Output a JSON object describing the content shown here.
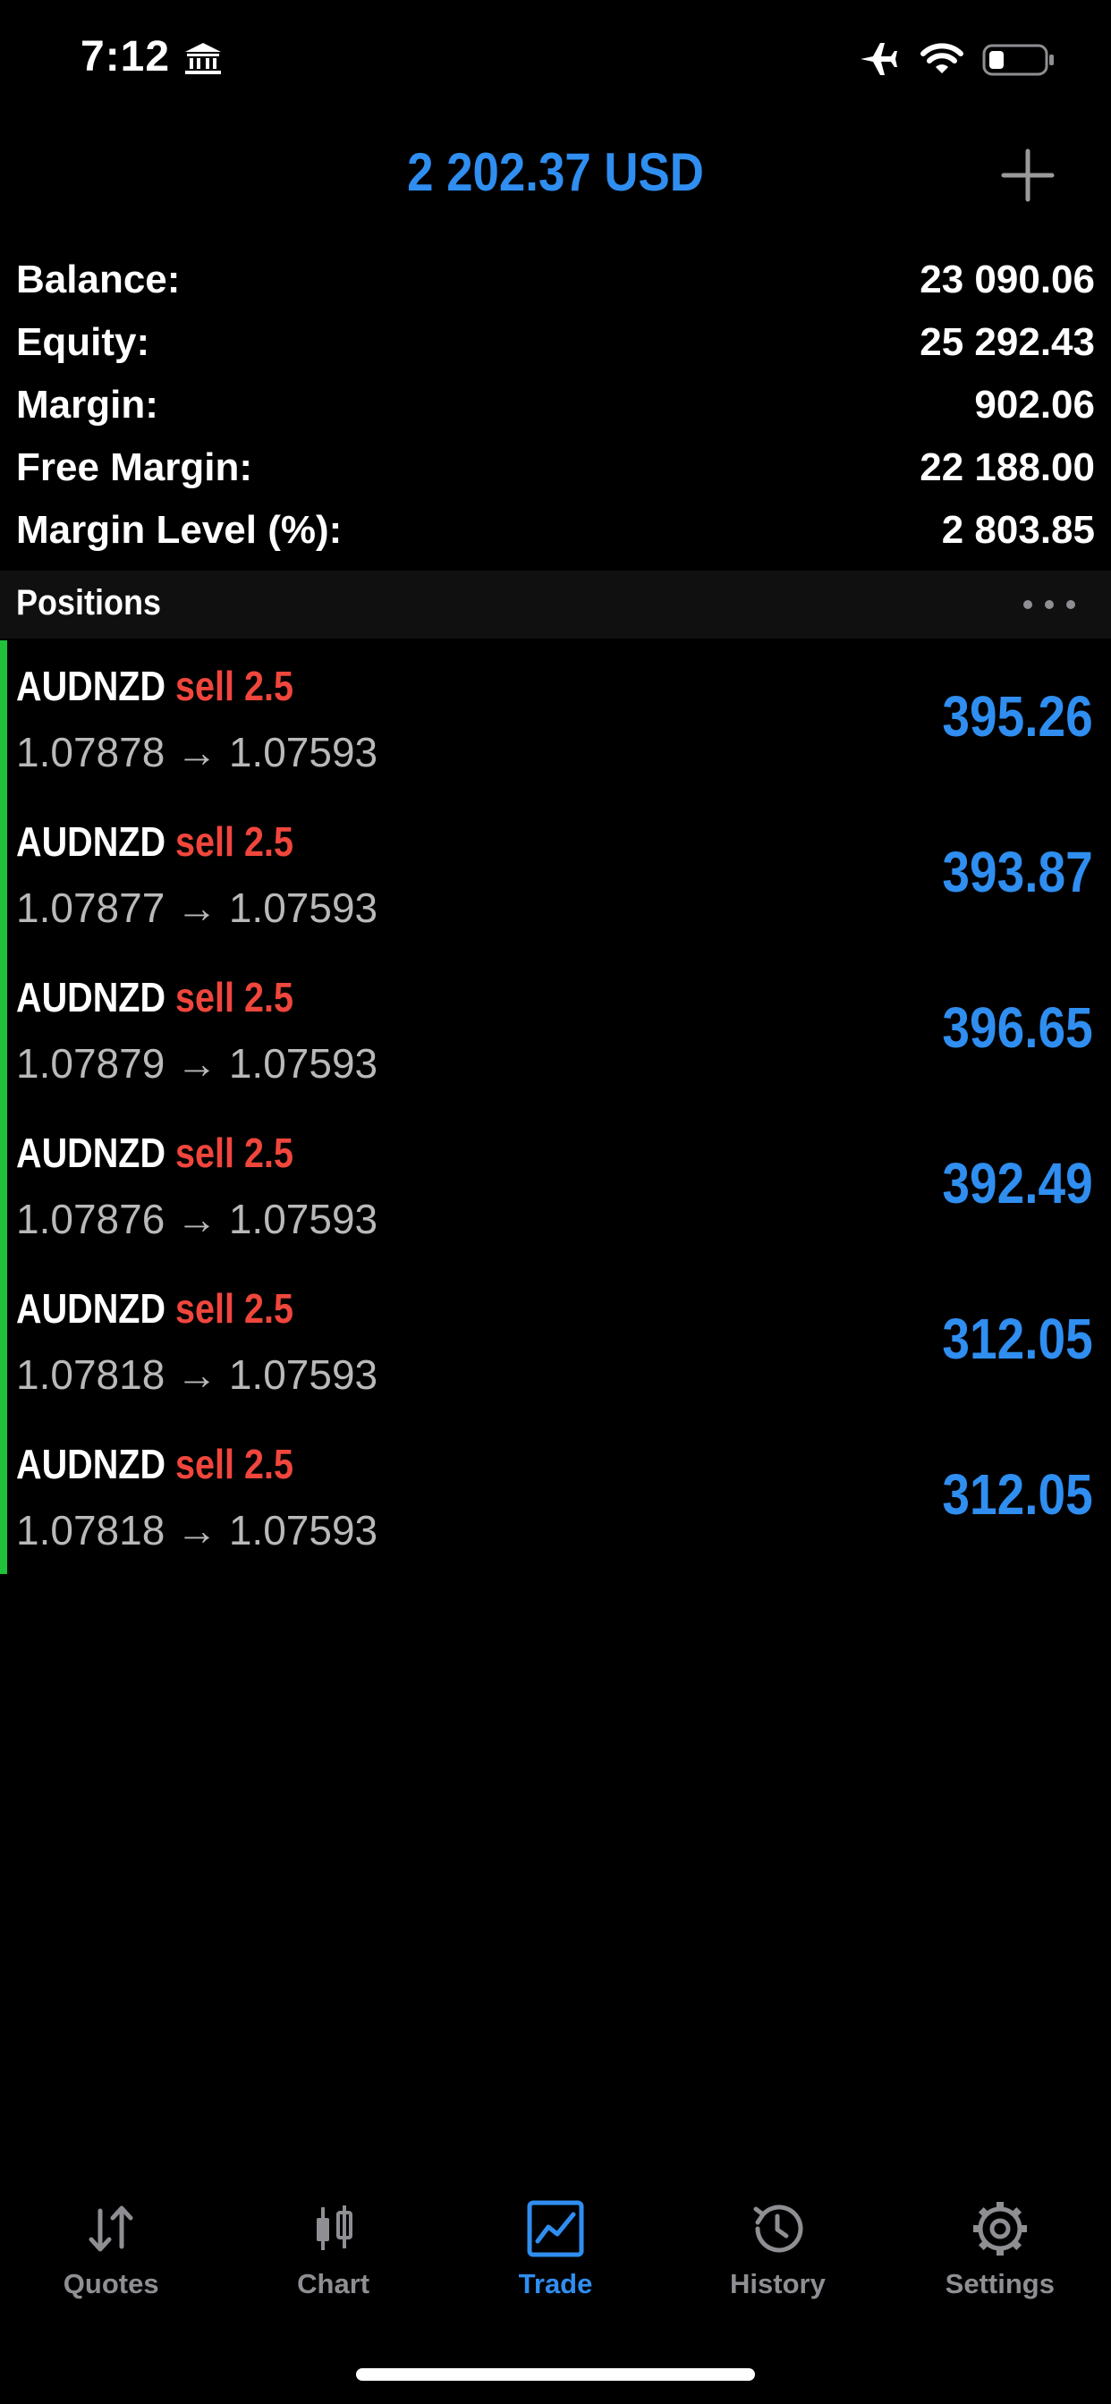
{
  "status_bar": {
    "time": "7:12",
    "icons": [
      "bank-icon",
      "airplane-icon",
      "wifi-icon",
      "battery-icon"
    ]
  },
  "header": {
    "amount": "2 202.37 USD",
    "add_icon": "plus-icon"
  },
  "summary": [
    {
      "label": "Balance:",
      "value": "23 090.06"
    },
    {
      "label": "Equity:",
      "value": "25 292.43"
    },
    {
      "label": "Margin:",
      "value": "902.06"
    },
    {
      "label": "Free Margin:",
      "value": "22 188.00"
    },
    {
      "label": "Margin Level (%):",
      "value": "2 803.85"
    }
  ],
  "positions_header": {
    "title": "Positions",
    "more_icon": "ellipsis-icon"
  },
  "positions": [
    {
      "symbol": "AUDNZD",
      "side": "sell 2.5",
      "prices": "1.07878 → 1.07593",
      "profit": "395.26"
    },
    {
      "symbol": "AUDNZD",
      "side": "sell 2.5",
      "prices": "1.07877 → 1.07593",
      "profit": "393.87"
    },
    {
      "symbol": "AUDNZD",
      "side": "sell 2.5",
      "prices": "1.07879 → 1.07593",
      "profit": "396.65"
    },
    {
      "symbol": "AUDNZD",
      "side": "sell 2.5",
      "prices": "1.07876 → 1.07593",
      "profit": "392.49"
    },
    {
      "symbol": "AUDNZD",
      "side": "sell 2.5",
      "prices": "1.07818 → 1.07593",
      "profit": "312.05"
    },
    {
      "symbol": "AUDNZD",
      "side": "sell 2.5",
      "prices": "1.07818 → 1.07593",
      "profit": "312.05"
    }
  ],
  "tabs": [
    {
      "label": "Quotes",
      "icon": "quotes-arrows-icon",
      "active": false
    },
    {
      "label": "Chart",
      "icon": "candlestick-icon",
      "active": false
    },
    {
      "label": "Trade",
      "icon": "trade-chart-icon",
      "active": true
    },
    {
      "label": "History",
      "icon": "history-clock-icon",
      "active": false
    },
    {
      "label": "Settings",
      "icon": "gear-icon",
      "active": false
    }
  ],
  "colors": {
    "accent": "#2f8ef0",
    "sell": "#f0463c",
    "position_bar": "#1fc23a",
    "muted": "#8e8e93"
  }
}
